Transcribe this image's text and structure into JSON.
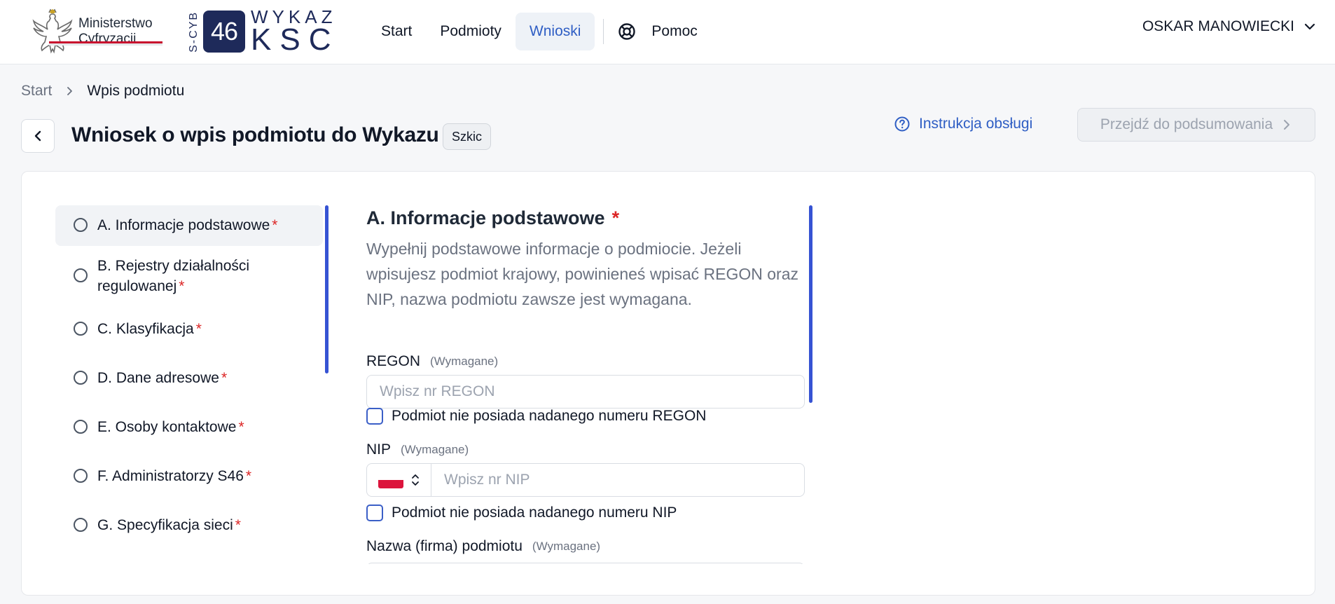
{
  "header": {
    "ministry_line1": "Ministerstwo",
    "ministry_line2": "Cyfryzacji",
    "ksc_vertical": "S-CYB",
    "ksc_box": "46",
    "ksc_line1": "WYKAZ",
    "ksc_line2": "KSC",
    "nav": {
      "start": "Start",
      "podmioty": "Podmioty",
      "wnioski": "Wnioski",
      "pomoc": "Pomoc"
    },
    "user_name": "OSKAR MANOWIECKI"
  },
  "breadcrumb": {
    "start": "Start",
    "current": "Wpis podmiotu"
  },
  "page": {
    "title": "Wniosek o wpis podmiotu do Wykazu",
    "status_badge": "Szkic",
    "instructions_link": "Instrukcja obsługi",
    "summary_button": "Przejdź do podsumowania"
  },
  "steps": [
    {
      "label": "A. Informacje podstawowe",
      "required": "*"
    },
    {
      "label": "B. Rejestry działalności regulowanej",
      "required": "*"
    },
    {
      "label": "C. Klasyfikacja",
      "required": "*"
    },
    {
      "label": "D. Dane adresowe",
      "required": "*"
    },
    {
      "label": "E. Osoby kontaktowe",
      "required": "*"
    },
    {
      "label": "F. Administratorzy S46",
      "required": "*"
    },
    {
      "label": "G. Specyfikacja sieci",
      "required": "*"
    }
  ],
  "section": {
    "title": "A. Informacje podstawowe",
    "required": "*",
    "description": "Wypełnij podstawowe informacje o podmiocie. Jeżeli wpisujesz podmiot krajowy, powinieneś wpisać REGON oraz NIP, nazwa podmiotu zawsze jest wymagana."
  },
  "form": {
    "regon": {
      "label": "REGON",
      "hint": "(Wymagane)",
      "placeholder": "Wpisz nr REGON",
      "no_number_checkbox": "Podmiot nie posiada nadanego numeru REGON"
    },
    "nip": {
      "label": "NIP",
      "hint": "(Wymagane)",
      "placeholder": "Wpisz nr NIP",
      "no_number_checkbox": "Podmiot nie posiada nadanego numeru NIP"
    },
    "name": {
      "label": "Nazwa (firma) podmiotu",
      "hint": "(Wymagane)"
    }
  },
  "colors": {
    "accent": "#2f5ec4",
    "progress_bar": "#3653d3",
    "required": "#dc2626",
    "brand_navy": "#1e2a5a"
  },
  "icons": {
    "logo": "eagle-emblem-icon",
    "help": "lifebuoy-icon",
    "user_menu": "chevron-down-icon",
    "back": "chevron-left-icon",
    "instructions": "question-circle-icon",
    "summary": "chevron-right-icon",
    "country_select": "chevron-up-down-icon"
  }
}
